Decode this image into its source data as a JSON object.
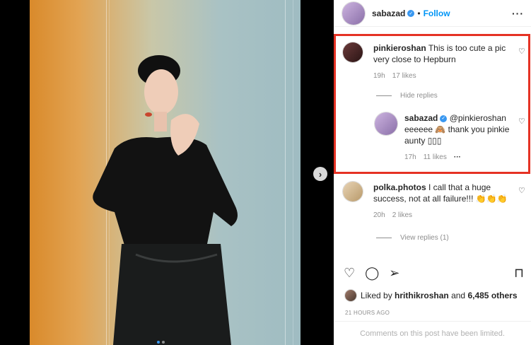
{
  "post": {
    "author": "sabazad",
    "separator": "•",
    "follow_label": "Follow",
    "more_label": "···",
    "next_arrow": "›"
  },
  "comments": [
    {
      "username": "pinkieroshan",
      "text": "This is too cute a pic very close to Hepburn",
      "time": "19h",
      "likes": "17 likes",
      "toggle": "Hide replies",
      "reply": {
        "username": "sabazad",
        "text": "@pinkieroshan eeeeee 🙈 thank you pinkie aunty ▯▯▯",
        "time": "17h",
        "likes": "11 likes",
        "more": "···"
      }
    },
    {
      "username": "polka.photos",
      "text": "I call that a huge success, not at all failure!!! 👏👏👏",
      "time": "20h",
      "likes": "2 likes",
      "toggle": "View replies (1)"
    }
  ],
  "likes_summary": {
    "prefix": "Liked by",
    "user": "hrithikroshan",
    "conj": "and",
    "others": "6,485 others"
  },
  "timestamp": "21 HOURS AGO",
  "limited_notice": "Comments on this post have been limited.",
  "icons": {
    "heart": "♡",
    "comment": "◯",
    "share": "➢",
    "save": "⊓"
  },
  "colors": {
    "accent": "#0095f6",
    "highlight": "#e53224"
  }
}
